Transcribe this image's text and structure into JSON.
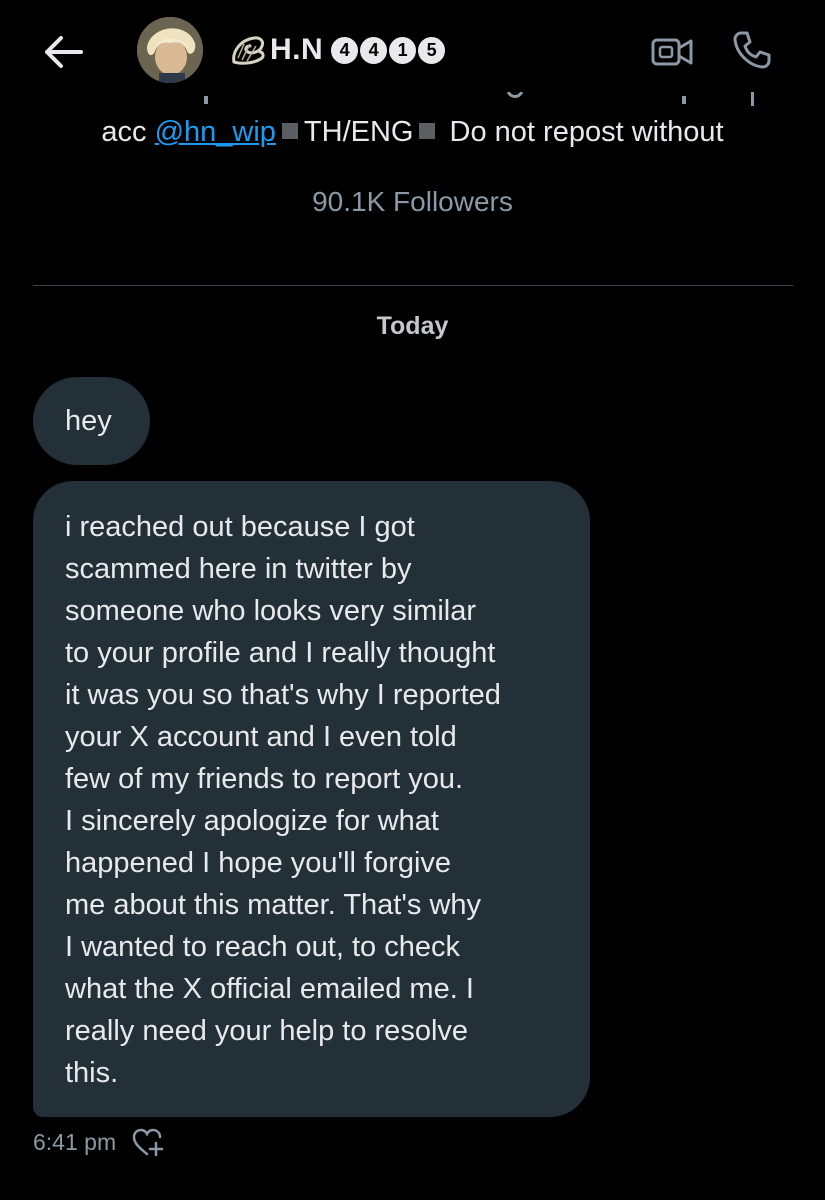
{
  "header": {
    "display_name": "H.N",
    "name_digits": [
      "4",
      "4",
      "1",
      "5"
    ],
    "icons": {
      "back": "arrow-left-icon",
      "shell": "spiral-shell-icon",
      "video": "video-camera-icon",
      "call": "phone-icon"
    }
  },
  "profile": {
    "bio_prefix": "acc ",
    "bio_mention": "@hn_wip",
    "bio_lang": "TH/ENG",
    "bio_rest": "Do not repost without",
    "followers": "90.1K Followers"
  },
  "conversation": {
    "date_separator": "Today",
    "messages": [
      {
        "text": "hey"
      },
      {
        "lines": [
          "i  reached out because I got",
          "scammed here in twitter by",
          "someone who looks very similar",
          "to your profile and I really thought",
          "it was you so that's why I reported",
          "your X account and I even told",
          "few of my friends to report you.",
          "I sincerely apologize for what",
          "happened I hope you'll forgive",
          "me about this matter. That's why",
          "I wanted to reach out, to check",
          "what the X official emailed me. I",
          "really need your help to resolve",
          "this."
        ]
      }
    ],
    "timestamp": "6:41 pm"
  },
  "colors": {
    "background": "#000000",
    "bubble": "#243038",
    "accent": "#1d9bf0",
    "muted": "#8b98a5"
  }
}
